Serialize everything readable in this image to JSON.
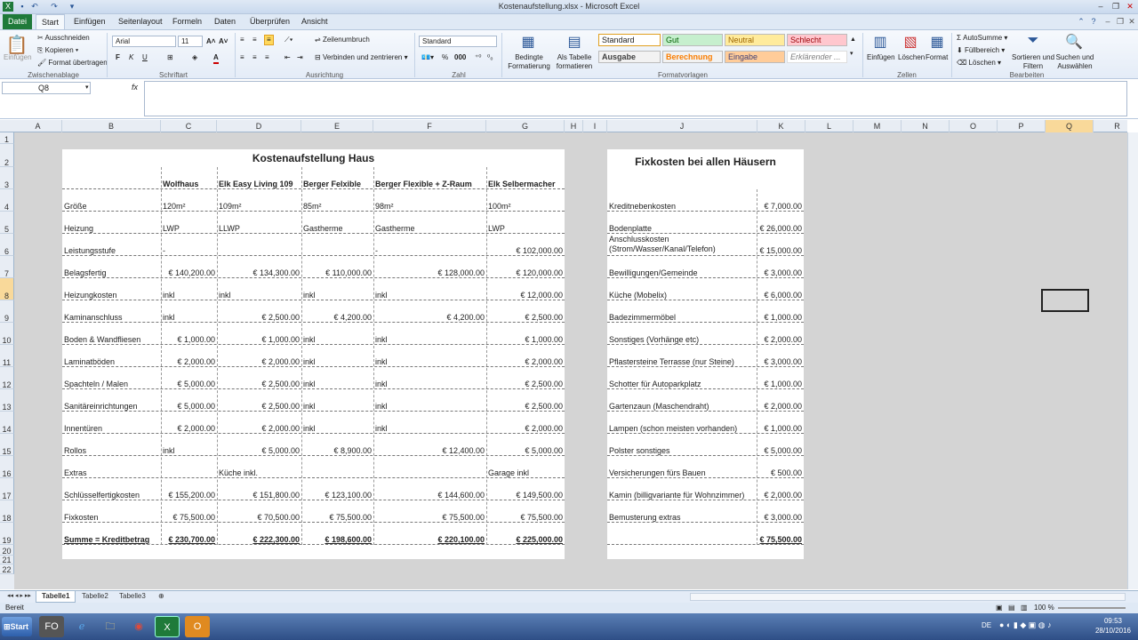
{
  "window": {
    "title": "Kostenaufstellung.xlsx - Microsoft Excel"
  },
  "ribbon_tabs": [
    "Datei",
    "Start",
    "Einfügen",
    "Seitenlayout",
    "Formeln",
    "Daten",
    "Überprüfen",
    "Ansicht"
  ],
  "ribbon": {
    "clipboard": {
      "paste": "Einfügen",
      "cut": "Ausschneiden",
      "copy": "Kopieren",
      "format_painter": "Format übertragen",
      "label": "Zwischenablage"
    },
    "font": {
      "name": "Arial",
      "size": "11",
      "label": "Schriftart"
    },
    "alignment": {
      "wrap": "Zeilenumbruch",
      "merge": "Verbinden und zentrieren",
      "label": "Ausrichtung"
    },
    "number": {
      "format": "Standard",
      "label": "Zahl"
    },
    "styles": {
      "cond_format": "Bedingte Formatierung",
      "as_table": "Als Tabelle formatieren",
      "items": [
        "Standard",
        "Gut",
        "Neutral",
        "Schlecht",
        "Ausgabe",
        "Berechnung",
        "Eingabe",
        "Erklärender ..."
      ],
      "label": "Formatvorlagen"
    },
    "cells": {
      "insert": "Einfügen",
      "delete": "Löschen",
      "format": "Format",
      "label": "Zellen"
    },
    "editing": {
      "autosum": "AutoSumme",
      "fill": "Füllbereich",
      "clear": "Löschen",
      "sort": "Sortieren und Filtern",
      "find": "Suchen und Auswählen",
      "label": "Bearbeiten"
    }
  },
  "formula_bar": {
    "name_box": "Q8",
    "fx": "fx",
    "content": ""
  },
  "columns": [
    "A",
    "B",
    "C",
    "D",
    "E",
    "F",
    "G",
    "H",
    "I",
    "J",
    "K",
    "L",
    "M",
    "N",
    "O",
    "P",
    "Q",
    "R"
  ],
  "rows": [
    "1",
    "2",
    "3",
    "4",
    "5",
    "6",
    "7",
    "8",
    "9",
    "10",
    "11",
    "12",
    "13",
    "14",
    "15",
    "16",
    "17",
    "18",
    "19",
    "20",
    "21",
    "22"
  ],
  "main_table": {
    "title": "Kostenaufstellung Haus",
    "headers": [
      "Wolfhaus",
      "Elk Easy Living 109",
      "Berger Felxible",
      "Berger Flexible + Z-Raum",
      "Elk Selbermacher"
    ],
    "rows": [
      {
        "label": "Größe",
        "values": [
          "120m²",
          "109m²",
          "85m²",
          "98m²",
          "100m²"
        ]
      },
      {
        "label": "Heizung",
        "values": [
          "LWP",
          "LLWP",
          "Gastherme",
          "Gastherme",
          "LWP"
        ]
      },
      {
        "label": "Leistungsstufe",
        "values": [
          "-",
          "",
          "",
          "-",
          "€ 102,000.00"
        ]
      },
      {
        "label": "Belagsfertig",
        "values": [
          "€ 140,200.00",
          "€ 134,300.00",
          "€ 110,000.00",
          "€ 128,000.00",
          "€ 120,000.00"
        ]
      },
      {
        "label": "Heizungkosten",
        "values": [
          "inkl",
          "inkl",
          "inkl",
          "inkl",
          "€ 12,000.00"
        ]
      },
      {
        "label": "Kaminanschluss",
        "values": [
          "inkl",
          "€ 2,500.00",
          "€ 4,200.00",
          "€ 4,200.00",
          "€ 2,500.00"
        ]
      },
      {
        "label": "Boden & Wandfliesen",
        "values": [
          "€ 1,000.00",
          "€ 1,000.00",
          "inkl",
          "inkl",
          "€ 1,000.00"
        ]
      },
      {
        "label": "Laminatböden",
        "values": [
          "€ 2,000.00",
          "€ 2,000.00",
          "inkl",
          "inkl",
          "€ 2,000.00"
        ]
      },
      {
        "label": "Spachteln / Malen",
        "values": [
          "€ 5,000.00",
          "€ 2,500.00",
          "inkl",
          "inkl",
          "€ 2,500.00"
        ]
      },
      {
        "label": "Sanitäreinrichtungen",
        "values": [
          "€ 5,000.00",
          "€ 2,500.00",
          "inkl",
          "inkl",
          "€ 2,500.00"
        ]
      },
      {
        "label": "Innentüren",
        "values": [
          "€ 2,000.00",
          "€ 2,000.00",
          "inkl",
          "inkl",
          "€ 2,000.00"
        ]
      },
      {
        "label": "Rollos",
        "values": [
          "inkl",
          "€ 5,000.00",
          "€ 8,900.00",
          "€ 12,400.00",
          "€ 5,000.00"
        ]
      },
      {
        "label": "Extras",
        "values": [
          "",
          "Küche inkl.",
          "",
          "",
          "Garage inkl"
        ]
      },
      {
        "label": "Schlüsselfertigkosten",
        "values": [
          "€ 155,200.00",
          "€ 151,800.00",
          "€ 123,100.00",
          "€ 144,600.00",
          "€ 149,500.00"
        ]
      },
      {
        "label": "Fixkosten",
        "values": [
          "€ 75,500.00",
          "€ 70,500.00",
          "€ 75,500.00",
          "€ 75,500.00",
          "€ 75,500.00"
        ]
      },
      {
        "label": "Summe = Kreditbetrag",
        "values": [
          "€ 230,700.00",
          "€ 222,300.00",
          "€ 198,600.00",
          "€ 220,100.00",
          "€ 225,000.00"
        ]
      }
    ]
  },
  "fix_table": {
    "title": "Fixkosten bei allen Häusern",
    "rows": [
      {
        "label": "Kreditnebenkosten",
        "value": "€ 7,000.00"
      },
      {
        "label": "Bodenplatte",
        "value": "€ 26,000.00"
      },
      {
        "label": "Anschlusskosten (Strom/Wasser/Kanal/Telefon)",
        "value": "€ 15,000.00"
      },
      {
        "label": "Bewilligungen/Gemeinde",
        "value": "€ 3,000.00"
      },
      {
        "label": "Küche (Mobelix)",
        "value": "€ 6,000.00"
      },
      {
        "label": "Badezimmermöbel",
        "value": "€ 1,000.00"
      },
      {
        "label": "Sonstiges (Vorhänge etc)",
        "value": "€ 2,000.00"
      },
      {
        "label": "Pflastersteine Terrasse (nur Steine)",
        "value": "€ 3,000.00"
      },
      {
        "label": "Schotter für Autoparkplatz",
        "value": "€ 1,000.00"
      },
      {
        "label": "Gartenzaun (Maschendraht)",
        "value": "€ 2,000.00"
      },
      {
        "label": "Lampen (schon meisten vorhanden)",
        "value": "€ 1,000.00"
      },
      {
        "label": "Polster sonstiges",
        "value": "€ 5,000.00"
      },
      {
        "label": "Versicherungen fürs Bauen",
        "value": "€ 500.00"
      },
      {
        "label": "Kamin (billigvariante für Wohnzimmer)",
        "value": "€ 2,000.00"
      },
      {
        "label": "Bemusterung extras",
        "value": "€ 3,000.00"
      },
      {
        "label": "",
        "value": "€ 75,500.00"
      }
    ]
  },
  "sheet_tabs": [
    "Tabelle1",
    "Tabelle2",
    "Tabelle3"
  ],
  "status": {
    "ready": "Bereit",
    "zoom": "100 %"
  },
  "taskbar": {
    "start": "Start",
    "lang": "DE",
    "time": "09:53",
    "date": "28/10/2016"
  }
}
